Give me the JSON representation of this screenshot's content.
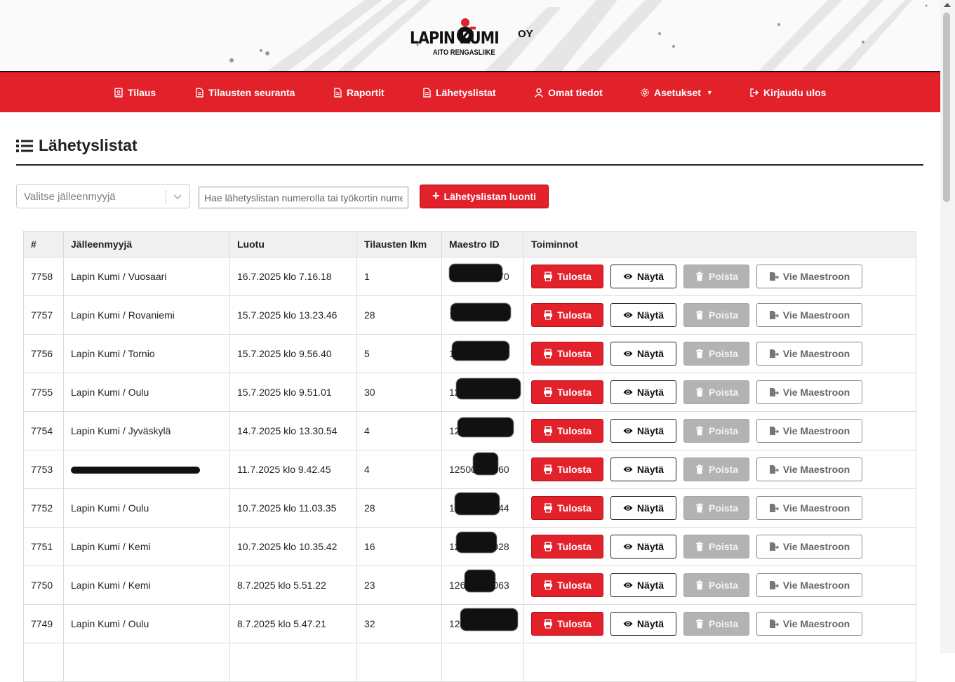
{
  "brand": {
    "name": "LAPIN KUMI",
    "suffix": "OY",
    "tagline": "AITO RENGASLIIKE"
  },
  "nav": [
    {
      "label": "Tilaus",
      "icon": "order-icon"
    },
    {
      "label": "Tilausten seuranta",
      "icon": "document-icon"
    },
    {
      "label": "Raportit",
      "icon": "document-icon"
    },
    {
      "label": "Lähetyslistat",
      "icon": "document-icon"
    },
    {
      "label": "Omat tiedot",
      "icon": "user-icon"
    },
    {
      "label": "Asetukset",
      "icon": "gear-icon"
    },
    {
      "label": "Kirjaudu ulos",
      "icon": "logout-icon"
    }
  ],
  "page": {
    "title": "Lähetyslistat"
  },
  "filters": {
    "dealer_placeholder": "Valitse jälleenmyyjä",
    "search_placeholder": "Hae lähetyslistan numerolla tai työkortin numerolla",
    "create_label": "Lähetyslistan luonti"
  },
  "table": {
    "headers": [
      "#",
      "Jälleenmyyjä",
      "Luotu",
      "Tilausten lkm",
      "Maestro ID",
      "Toiminnot"
    ],
    "actions": {
      "print": "Tulosta",
      "show": "Näytä",
      "delete": "Poista",
      "export": "Vie Maestroon"
    },
    "rows": [
      {
        "id": "7758",
        "dealer": "Lapin Kumi / Vuosaari",
        "created": "16.7.2025 klo 7.16.18",
        "count": "1",
        "maestro": "12600000070"
      },
      {
        "id": "7757",
        "dealer": "Lapin Kumi / Rovaniemi",
        "created": "15.7.2025 klo 13.23.46",
        "count": "28",
        "maestro": "12600000041"
      },
      {
        "id": "7756",
        "dealer": "Lapin Kumi / Tornio",
        "created": "15.7.2025 klo 9.56.40",
        "count": "5",
        "maestro": "12600000072"
      },
      {
        "id": "7755",
        "dealer": "Lapin Kumi / Oulu",
        "created": "15.7.2025 klo 9.51.01",
        "count": "30",
        "maestro": "12600000009"
      },
      {
        "id": "7754",
        "dealer": "Lapin Kumi / Jyväskylä",
        "created": "14.7.2025 klo 13.30.54",
        "count": "4",
        "maestro": "12600000056"
      },
      {
        "id": "7753",
        "dealer": "",
        "created": "11.7.2025 klo 9.42.45",
        "count": "4",
        "maestro": "12500000060"
      },
      {
        "id": "7752",
        "dealer": "Lapin Kumi / Oulu",
        "created": "10.7.2025 klo 11.03.35",
        "count": "28",
        "maestro": "12000000044"
      },
      {
        "id": "7751",
        "dealer": "Lapin Kumi / Kemi",
        "created": "10.7.2025 klo 10.35.42",
        "count": "16",
        "maestro": "12000000028"
      },
      {
        "id": "7750",
        "dealer": "Lapin Kumi / Kemi",
        "created": "8.7.2025 klo 5.51.22",
        "count": "23",
        "maestro": "12600000063"
      },
      {
        "id": "7749",
        "dealer": "Lapin Kumi / Oulu",
        "created": "8.7.2025 klo 5.47.21",
        "count": "32",
        "maestro": "12600000050"
      },
      {
        "id": "",
        "dealer": "",
        "created": "",
        "count": "",
        "maestro": ""
      }
    ]
  },
  "colors": {
    "primary": "#e3212a",
    "delete_disabled": "#b3b3b3"
  }
}
